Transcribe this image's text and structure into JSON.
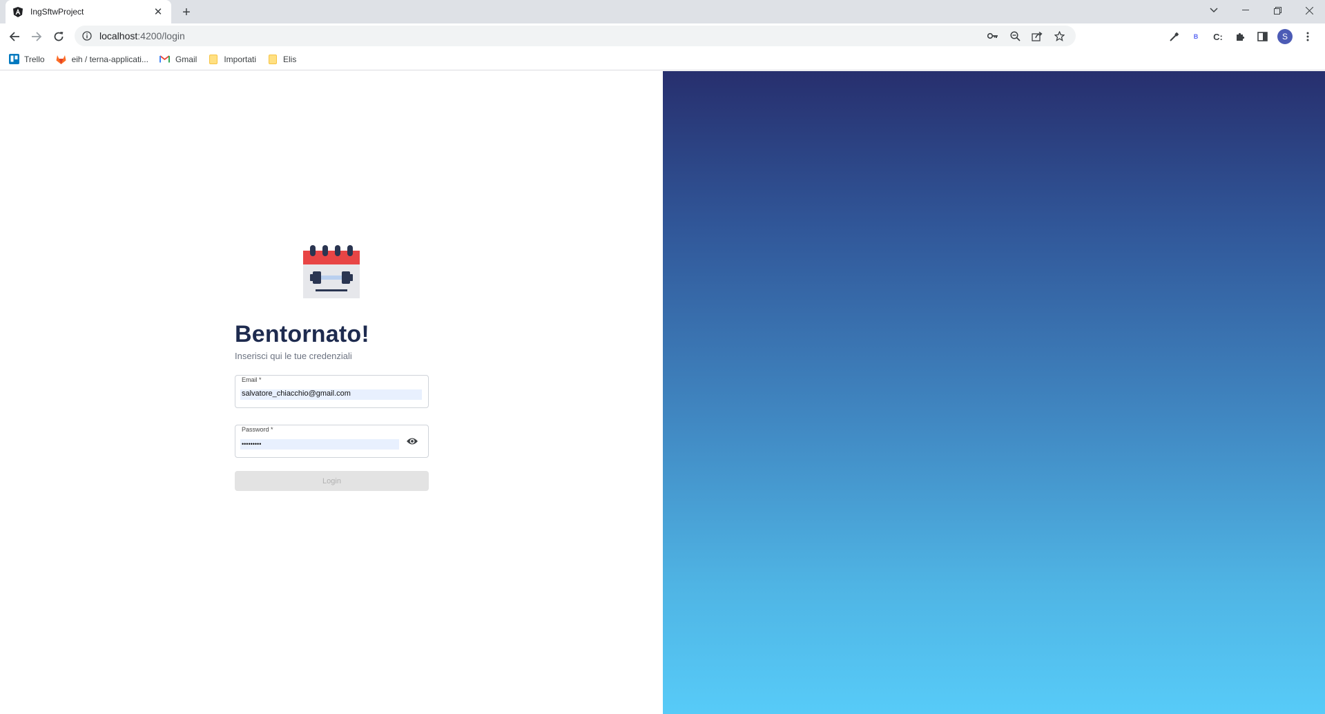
{
  "browser": {
    "tab_title": "IngSftwProject",
    "tab_close": "✕",
    "new_tab": "+",
    "url_host": "localhost",
    "url_path": ":4200/login",
    "window_controls": [
      "chevron-down",
      "minimize",
      "restore",
      "close"
    ],
    "bookmarks": [
      {
        "label": "Trello",
        "icon": "trello-icon"
      },
      {
        "label": "eih / terna-applicati...",
        "icon": "gitlab-icon"
      },
      {
        "label": "Gmail",
        "icon": "gmail-icon"
      },
      {
        "label": "Importati",
        "icon": "folder-icon"
      },
      {
        "label": "Elis",
        "icon": "folder-icon"
      }
    ],
    "profile_initial": "S"
  },
  "login": {
    "heading": "Bentornato!",
    "subheading": "Inserisci qui le tue credenziali",
    "email_label": "Email *",
    "email_value": "salvatore_chiacchio@gmail.com",
    "password_label": "Password *",
    "password_value": "•••••••••",
    "login_button": "Login"
  },
  "colors": {
    "heading": "#1e2b4f",
    "gradient_top": "#272f6e",
    "gradient_bottom": "#57cbf8",
    "logo_red": "#e84545",
    "logo_dark": "#2a3551"
  }
}
